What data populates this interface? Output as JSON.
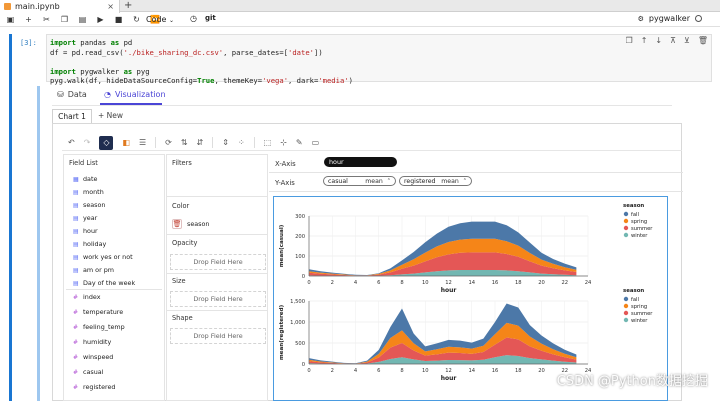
{
  "tab": {
    "filename": "main.ipynb",
    "new_tab": "+"
  },
  "toolbar": {
    "icons": [
      "save-icon",
      "add-cell-icon",
      "cut-icon",
      "copy-icon",
      "paste-icon",
      "run-icon",
      "stop-icon",
      "restart-icon",
      "run-all-icon"
    ],
    "cell_type": "Code",
    "git_label": "git",
    "kernel_name": "pygwalker"
  },
  "cell": {
    "prompt": "[3]:",
    "code_lines": [
      [
        {
          "t": "import",
          "c": "kw"
        },
        {
          "t": " pandas ",
          "c": ""
        },
        {
          "t": "as",
          "c": "kw"
        },
        {
          "t": " pd",
          "c": ""
        }
      ],
      [
        {
          "t": "df = pd.read_csv(",
          "c": ""
        },
        {
          "t": "'./bike_sharing_dc.csv'",
          "c": "str"
        },
        {
          "t": ", parse_dates=[",
          "c": ""
        },
        {
          "t": "'date'",
          "c": "str"
        },
        {
          "t": "])",
          "c": ""
        }
      ],
      [
        {
          "t": "",
          "c": ""
        }
      ],
      [
        {
          "t": "import",
          "c": "kw"
        },
        {
          "t": " pygwalker ",
          "c": ""
        },
        {
          "t": "as",
          "c": "kw"
        },
        {
          "t": " pyg",
          "c": ""
        }
      ],
      [
        {
          "t": "pyg.walk(df, hideDataSourceConfig=",
          "c": ""
        },
        {
          "t": "True",
          "c": "kw"
        },
        {
          "t": ", themeKey=",
          "c": ""
        },
        {
          "t": "'vega'",
          "c": "str"
        },
        {
          "t": ", dark=",
          "c": ""
        },
        {
          "t": "'media'",
          "c": "str"
        },
        {
          "t": ")",
          "c": ""
        }
      ]
    ]
  },
  "output_tabs": {
    "data": "Data",
    "visualization": "Visualization"
  },
  "chart_tabs": {
    "active": "Chart 1",
    "new": "+ New"
  },
  "field_list": {
    "title": "Field List",
    "dimensions": [
      "date",
      "month",
      "season",
      "year",
      "hour",
      "holiday",
      "work yes or not",
      "am or pm",
      "Day of the week"
    ],
    "measures": [
      "index",
      "temperature",
      "feeling_temp",
      "humidity",
      "winspeed",
      "casual",
      "registered"
    ]
  },
  "encodings": {
    "filters": "Filters",
    "color": "Color",
    "color_field": "season",
    "opacity": "Opacity",
    "size": "Size",
    "shape": "Shape",
    "drop_hint": "Drop Field Here"
  },
  "shelves": {
    "x_label": "X-Axis",
    "x_field": "hour",
    "y_label": "Y-Axis",
    "y_fields": [
      {
        "field": "casual",
        "agg": "mean"
      },
      {
        "field": "registered",
        "agg": "mean"
      }
    ]
  },
  "chart_data": [
    {
      "type": "area",
      "stacked": true,
      "x": [
        0,
        1,
        2,
        3,
        4,
        5,
        6,
        7,
        8,
        9,
        10,
        11,
        12,
        13,
        14,
        15,
        16,
        17,
        18,
        19,
        20,
        21,
        22,
        23
      ],
      "xlabel": "hour",
      "ylabel": "mean(casual)",
      "ylim": [
        0,
        300
      ],
      "yticks": [
        0,
        100,
        200,
        300
      ],
      "xticks": [
        0,
        2,
        4,
        6,
        8,
        10,
        12,
        14,
        16,
        18,
        20,
        22,
        24
      ],
      "legend_title": "season",
      "legend_position": "right",
      "series": [
        {
          "name": "winter",
          "color": "#72b7b2",
          "values": [
            3,
            2,
            1,
            1,
            1,
            1,
            2,
            4,
            8,
            12,
            18,
            24,
            28,
            30,
            30,
            30,
            30,
            28,
            24,
            18,
            12,
            9,
            6,
            4
          ]
        },
        {
          "name": "summer",
          "color": "#e45756",
          "values": [
            13,
            9,
            7,
            4,
            2,
            2,
            5,
            14,
            28,
            40,
            55,
            70,
            80,
            86,
            88,
            88,
            88,
            82,
            72,
            55,
            40,
            30,
            22,
            16
          ]
        },
        {
          "name": "spring",
          "color": "#f58518",
          "values": [
            8,
            6,
            4,
            3,
            1,
            1,
            4,
            10,
            20,
            32,
            44,
            54,
            62,
            66,
            68,
            68,
            68,
            64,
            56,
            42,
            30,
            22,
            16,
            11
          ]
        },
        {
          "name": "fall",
          "color": "#4c78a8",
          "values": [
            10,
            7,
            5,
            3,
            2,
            1,
            3,
            10,
            22,
            36,
            52,
            64,
            76,
            82,
            86,
            86,
            86,
            80,
            66,
            52,
            34,
            24,
            18,
            12
          ]
        }
      ]
    },
    {
      "type": "area",
      "stacked": true,
      "x": [
        0,
        1,
        2,
        3,
        4,
        5,
        6,
        7,
        8,
        9,
        10,
        11,
        12,
        13,
        14,
        15,
        16,
        17,
        18,
        19,
        20,
        21,
        22,
        23
      ],
      "xlabel": "hour",
      "ylabel": "mean(registered)",
      "ylim": [
        0,
        1500
      ],
      "yticks": [
        0,
        500,
        1000,
        1500
      ],
      "xticks": [
        0,
        2,
        4,
        6,
        8,
        10,
        12,
        14,
        16,
        18,
        20,
        22,
        24
      ],
      "legend_title": "season",
      "legend_position": "right",
      "series": [
        {
          "name": "winter",
          "color": "#72b7b2",
          "values": [
            20,
            12,
            8,
            4,
            3,
            12,
            50,
            120,
            160,
            110,
            70,
            80,
            95,
            92,
            85,
            100,
            160,
            210,
            190,
            140,
            110,
            80,
            55,
            35
          ]
        },
        {
          "name": "summer",
          "color": "#e45756",
          "values": [
            45,
            28,
            18,
            8,
            5,
            25,
            105,
            270,
            340,
            210,
            130,
            150,
            175,
            170,
            155,
            185,
            300,
            420,
            395,
            280,
            205,
            150,
            105,
            70
          ]
        },
        {
          "name": "spring",
          "color": "#f58518",
          "values": [
            35,
            20,
            14,
            7,
            5,
            20,
            85,
            230,
            300,
            175,
            100,
            120,
            140,
            135,
            125,
            150,
            250,
            350,
            330,
            235,
            170,
            120,
            85,
            55
          ]
        },
        {
          "name": "fall",
          "color": "#4c78a8",
          "values": [
            40,
            25,
            16,
            8,
            5,
            22,
            95,
            260,
            520,
            230,
            120,
            140,
            165,
            160,
            145,
            170,
            290,
            460,
            430,
            270,
            195,
            140,
            95,
            65
          ]
        }
      ]
    }
  ],
  "watermark": "CSDN @Python数据挖掘"
}
